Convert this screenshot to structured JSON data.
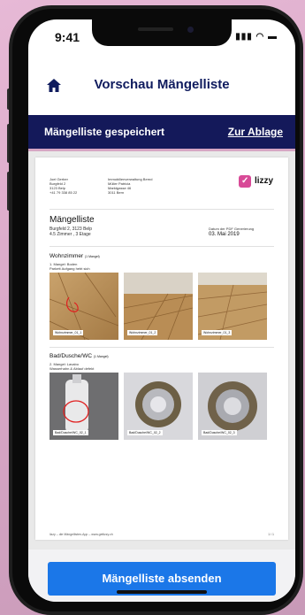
{
  "status_bar": {
    "time": "9:41",
    "signal_wifi_battery": "▮▮▮ ◠ ▬"
  },
  "header": {
    "title": "Vorschau Mängelliste",
    "home_icon": "home-icon"
  },
  "bar": {
    "saved_label": "Mängelliste gespeichert",
    "archive_link": "Zur Ablage"
  },
  "document": {
    "sender": [
      "Joel Gerber",
      "Burgfeld 2",
      "3123 Belp",
      "+41 79 338 85 22"
    ],
    "recipient": [
      "Immobilienverwaltung Bernd",
      "Müller Patricia",
      "Marktgasse 46",
      "3011 Bern"
    ],
    "logo_text": "lizzy",
    "title": "Mängelliste",
    "address": "Burgfeld 2, 3123 Belp",
    "rooms_floor": "4.5 Zimmer , 3 Etage",
    "date_label": "Datum der PDF Generierung",
    "date": "03. Mai 2019",
    "sections": [
      {
        "name": "Wohnzimmer",
        "count": "(1 Mangel)",
        "defect_title": "1. Mangel: Boden",
        "defect_desc": "Parkett Aufgang hebt sich",
        "photos": [
          "Wohnzimmer_01_1",
          "Wohnzimmer_01_2",
          "Wohnzimmer_01_3"
        ]
      },
      {
        "name": "Bad/Dusche/WC",
        "count": "(1 Mangel)",
        "defect_title": "2. Mangel: Lavabo",
        "defect_desc": "Wasserhahn & Ablauf defekt",
        "photos": [
          "Bad/Dusche/WC_02_1",
          "Bad/Dusche/WC_02_2",
          "Bad/Dusche/WC_02_3"
        ]
      }
    ],
    "footer_left": "lizzy – die Mängellisten-App – www.getlizzy.ch",
    "footer_right": "1 / 1"
  },
  "send_button": "Mängelliste absenden",
  "colors": {
    "navy": "#14195a",
    "title": "#0f1b5e",
    "accent": "#1b77e8",
    "brand_pink": "#d84a97"
  }
}
